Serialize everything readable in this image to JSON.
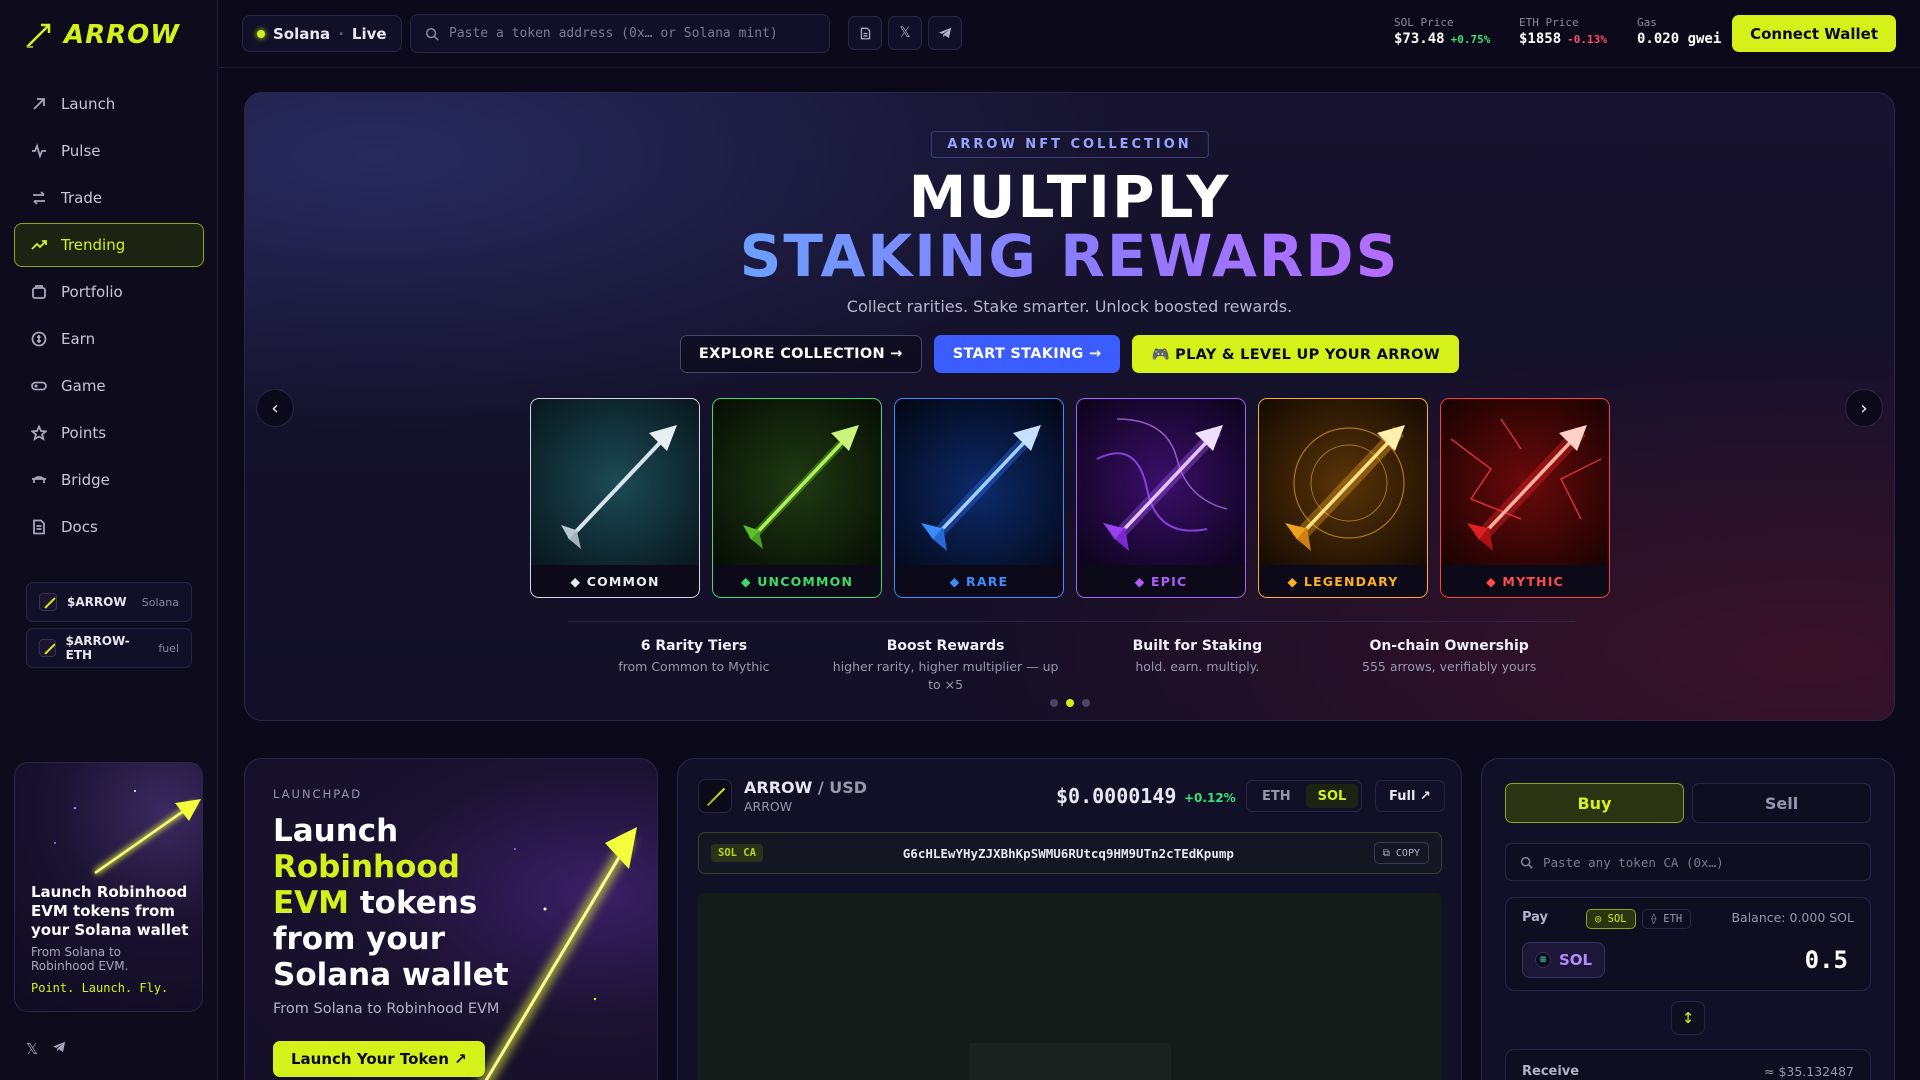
{
  "brand": {
    "name": "ARROW"
  },
  "sidebar": {
    "items": [
      {
        "label": "Launch",
        "icon": "arrow-up-right-icon"
      },
      {
        "label": "Pulse",
        "icon": "pulse-icon"
      },
      {
        "label": "Trade",
        "icon": "swap-icon"
      },
      {
        "label": "Trending",
        "icon": "trending-up-icon",
        "active": true
      },
      {
        "label": "Portfolio",
        "icon": "briefcase-icon"
      },
      {
        "label": "Earn",
        "icon": "coin-icon"
      },
      {
        "label": "Game",
        "icon": "gamepad-icon"
      },
      {
        "label": "Points",
        "icon": "star-icon"
      },
      {
        "label": "Bridge",
        "icon": "bridge-icon"
      },
      {
        "label": "Docs",
        "icon": "document-icon"
      }
    ],
    "tokens": [
      {
        "symbol": "$ARROW",
        "network": "Solana"
      },
      {
        "symbol": "$ARROW-ETH",
        "network": "fuel"
      }
    ],
    "promo": {
      "title": "Launch Robinhood EVM tokens from your Solana wallet",
      "subtitle": "From Solana to Robinhood EVM.",
      "tagline": "Point. Launch. Fly."
    }
  },
  "topbar": {
    "network": "Solana",
    "status": "Live",
    "search_placeholder": "Paste a token address (0x… or Solana mint)",
    "sol_price": {
      "label": "SOL Price",
      "value": "$73.48",
      "change": "+0.75%"
    },
    "eth_price": {
      "label": "ETH Price",
      "value": "$1858",
      "change": "-0.13%"
    },
    "gas": {
      "label": "Gas",
      "value": "0.020 gwei"
    },
    "connect_label": "Connect Wallet"
  },
  "hero": {
    "badge": "ARROW NFT COLLECTION",
    "title_line1": "MULTIPLY",
    "title_line2": "STAKING REWARDS",
    "subtitle": "Collect rarities. Stake smarter. Unlock boosted rewards.",
    "buttons": {
      "explore": "EXPLORE COLLECTION →",
      "stake": "START STAKING →",
      "play": "🎮 PLAY & LEVEL UP YOUR ARROW"
    },
    "prev_label": "‹",
    "next_label": "›",
    "cards": [
      {
        "name": "◆ COMMON",
        "color": "#cfd8e0"
      },
      {
        "name": "◆ UNCOMMON",
        "color": "#3ddc6a"
      },
      {
        "name": "◆ RARE",
        "color": "#3f8cff"
      },
      {
        "name": "◆ EPIC",
        "color": "#b05cff"
      },
      {
        "name": "◆ LEGENDARY",
        "color": "#ffb020"
      },
      {
        "name": "◆ MYTHIC",
        "color": "#ff3b3b"
      }
    ],
    "features": [
      {
        "title": "6 Rarity Tiers",
        "desc": "from Common to Mythic"
      },
      {
        "title": "Boost Rewards",
        "desc": "higher rarity, higher multiplier — up to ×5"
      },
      {
        "title": "Built for Staking",
        "desc": "hold. earn. multiply."
      },
      {
        "title": "On-chain Ownership",
        "desc": "555 arrows, verifiably yours"
      }
    ]
  },
  "launchpad": {
    "eyebrow": "LAUNCHPAD",
    "title_a": "Launch",
    "title_b": "Robinhood EVM",
    "title_c": "tokens from your Solana wallet",
    "subtitle": "From Solana to Robinhood EVM",
    "button": "Launch Your Token ↗"
  },
  "chart_panel": {
    "base": "ARROW",
    "quote": "/ USD",
    "sub": "ARROW",
    "price": "$0.0000149",
    "change": "+0.12%",
    "chains": [
      "ETH",
      "SOL"
    ],
    "active_chain": "SOL",
    "full_label": "Full ↗",
    "ca_tag": "SOL CA",
    "ca_address": "G6cHLEwYHyZJXBhKpSWMU6RUtcq9HM9UTn2cTEdKpump",
    "copy_label": "⧉ COPY"
  },
  "swap": {
    "buy_label": "Buy",
    "sell_label": "Sell",
    "search_placeholder": "Paste any token CA (0x…)",
    "pay_label": "Pay",
    "pay_sol": "◎ SOL",
    "pay_eth": "⟠ ETH",
    "balance": "Balance: 0.000 SOL",
    "token": "SOL",
    "amount": "0.5",
    "flip": "↕",
    "receive_label": "Receive",
    "receive_value": "≈ $35.132487"
  }
}
